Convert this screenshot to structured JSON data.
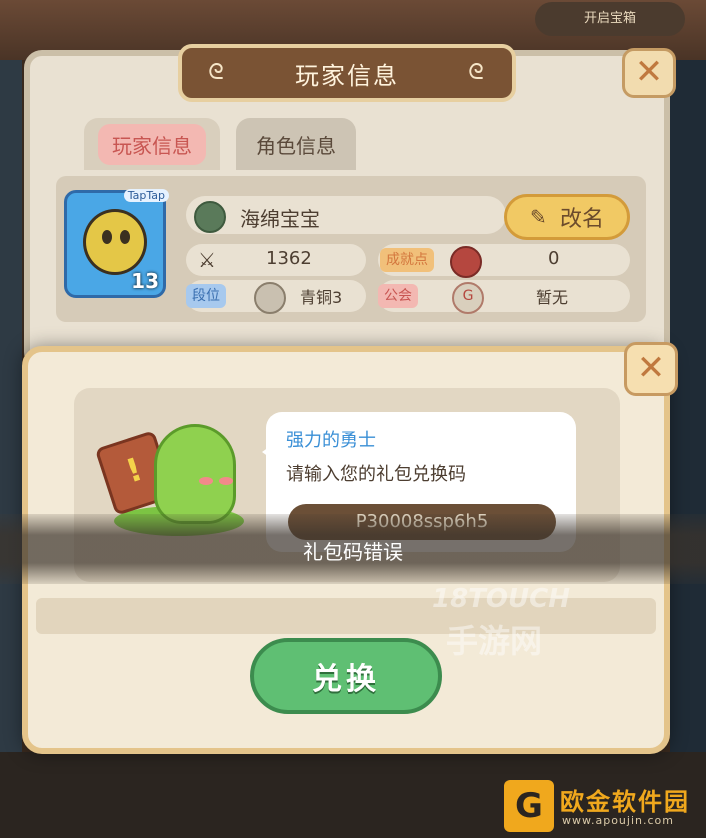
{
  "top_bar": {
    "right_pill": "开启宝箱"
  },
  "player_panel": {
    "title": "玩家信息",
    "tabs": [
      {
        "label": "玩家信息"
      },
      {
        "label": "角色信息"
      }
    ],
    "avatar": {
      "level": "13",
      "tag": "TapTap"
    },
    "name": "海绵宝宝",
    "rename_label": "改名",
    "power": "1362",
    "achievement_label": "成就点",
    "achievement_value": "0",
    "rank_label": "段位",
    "rank_value": "青铜3",
    "guild_label": "公会",
    "guild_value": "暂无"
  },
  "redeem_popup": {
    "speaker": "强力的勇士",
    "prompt": "请输入您的礼包兑换码",
    "code_value": "P30008ssp6h5",
    "error_message": "礼包码错误",
    "redeem_label": "兑换"
  },
  "watermark": {
    "line1": "18TOUCH",
    "line2": "手游网"
  },
  "brand": {
    "logo_char": "G",
    "name": "欧金软件园",
    "url": "www.apoujin.com"
  },
  "colors": {
    "accent_green": "#5fbf73",
    "title_brown": "#7a5334",
    "link_blue": "#3a8fd6",
    "rename_yellow": "#f1c964"
  }
}
